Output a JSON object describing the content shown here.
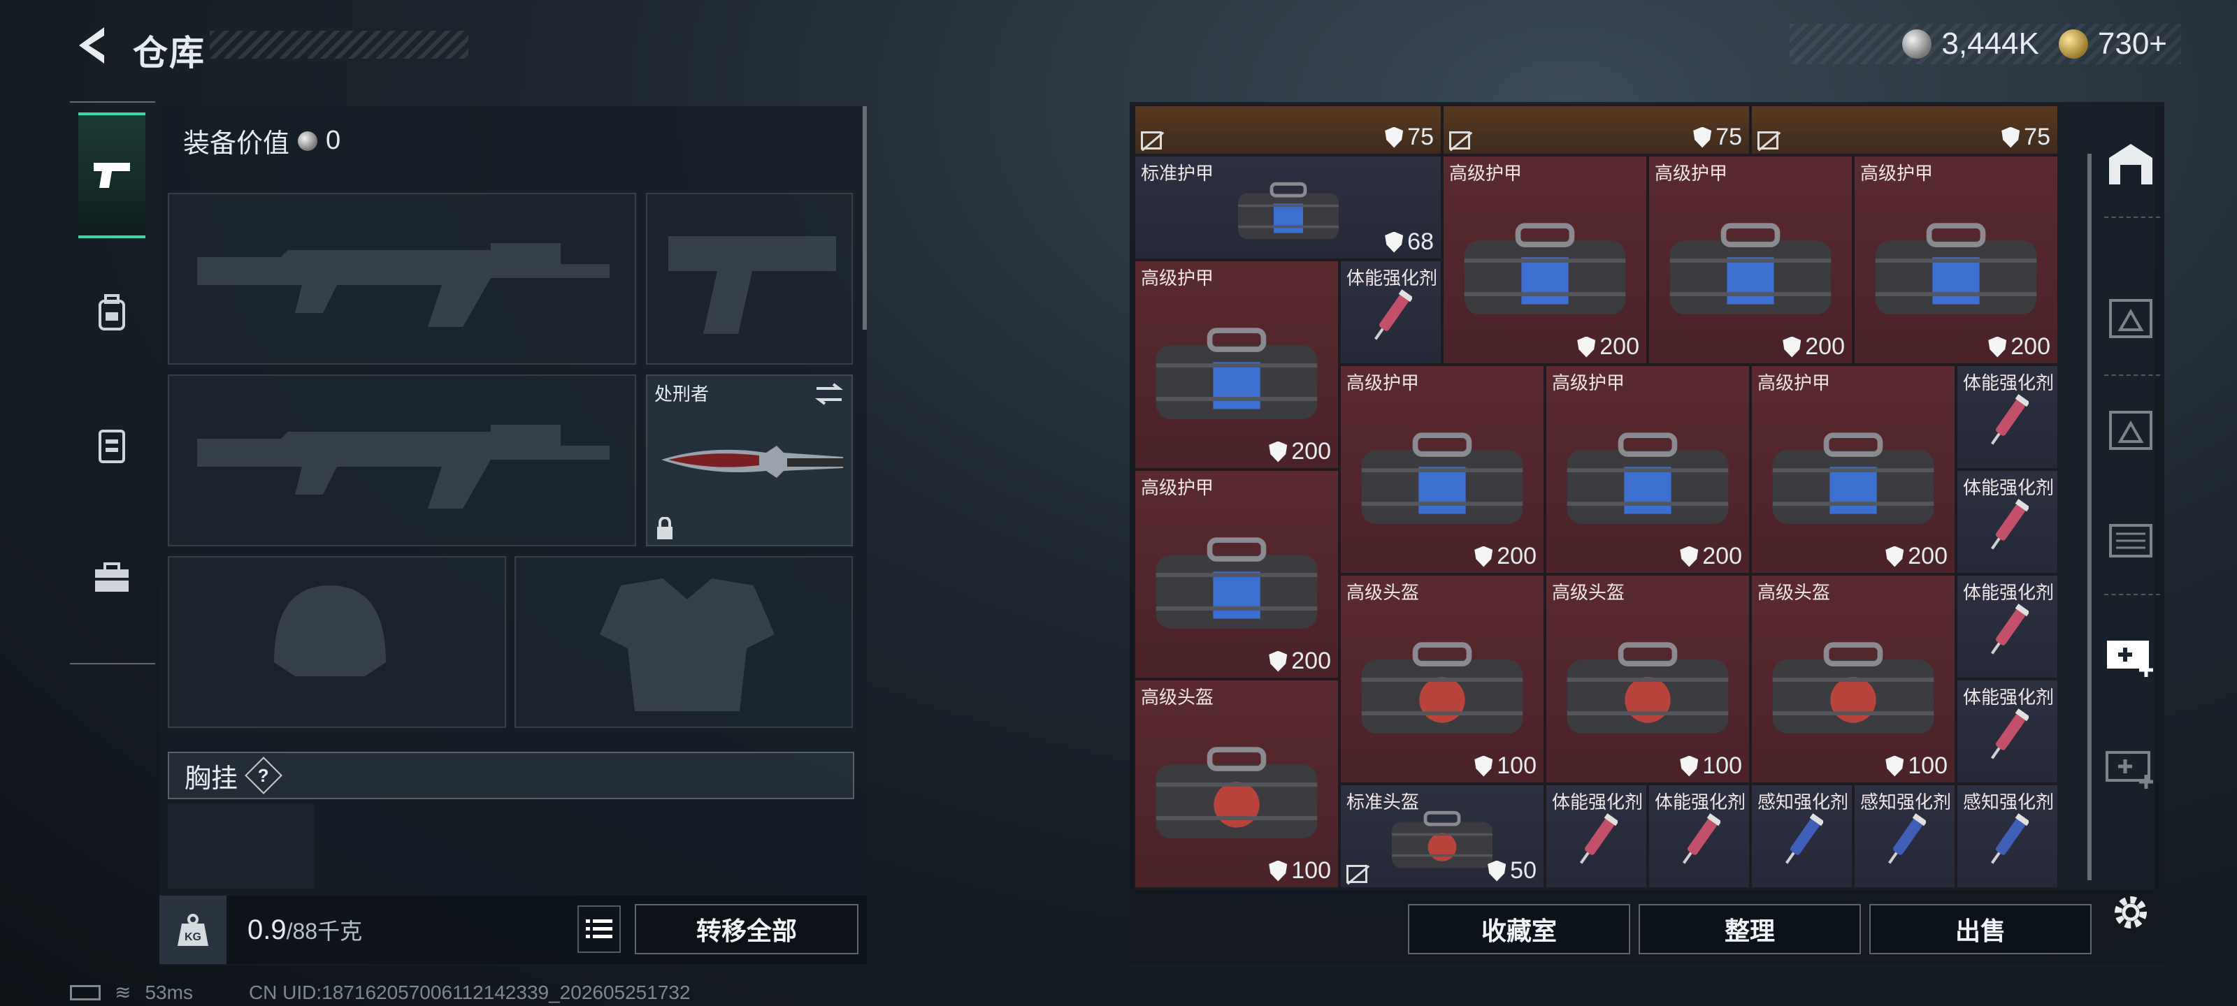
{
  "header": {
    "title": "仓库",
    "silver_amount": "3,444K",
    "gold_amount": "730",
    "gold_plus": "+"
  },
  "loadout": {
    "value_label": "装备价值",
    "value": "0",
    "knife_name": "处刑者",
    "chest_label": "胸挂",
    "chest_help": "?",
    "weight_current": "0.9",
    "weight_max": "/88千克",
    "transfer_all": "转移全部"
  },
  "stash": {
    "top_row": [
      {
        "value": "75"
      },
      {
        "value": "75"
      },
      {
        "value": "75"
      }
    ],
    "cells": [
      {
        "name": "标准护甲",
        "value": "68",
        "color": "dark",
        "type": "armor-bag"
      },
      {
        "name": "高级护甲",
        "value": "200",
        "color": "red",
        "type": "armor-bag"
      },
      {
        "name": "高级护甲",
        "value": "200",
        "color": "red",
        "type": "armor-bag"
      },
      {
        "name": "高级护甲",
        "value": "200",
        "color": "red",
        "type": "armor-bag"
      },
      {
        "name": "高级护甲",
        "value": "200",
        "color": "red",
        "type": "armor-bag"
      },
      {
        "name": "体能强化剂",
        "color": "dark",
        "type": "syringe-red"
      },
      {
        "name": "高级护甲",
        "value": "200",
        "color": "red",
        "type": "armor-bag"
      },
      {
        "name": "高级护甲",
        "value": "200",
        "color": "red",
        "type": "armor-bag"
      },
      {
        "name": "高级护甲",
        "value": "200",
        "color": "red",
        "type": "armor-bag"
      },
      {
        "name": "体能强化剂",
        "color": "dark",
        "type": "syringe-red"
      },
      {
        "name": "高级护甲",
        "value": "200",
        "color": "red",
        "type": "armor-bag"
      },
      {
        "name": "体能强化剂",
        "color": "dark",
        "type": "syringe-red"
      },
      {
        "name": "高级头盔",
        "value": "100",
        "color": "red",
        "type": "helmet-bag"
      },
      {
        "name": "高级头盔",
        "value": "100",
        "color": "red",
        "type": "helmet-bag"
      },
      {
        "name": "高级头盔",
        "value": "100",
        "color": "red",
        "type": "helmet-bag"
      },
      {
        "name": "体能强化剂",
        "color": "dark",
        "type": "syringe-red"
      },
      {
        "name": "高级头盔",
        "value": "100",
        "color": "red",
        "type": "helmet-bag"
      },
      {
        "name": "体能强化剂",
        "color": "dark",
        "type": "syringe-red"
      },
      {
        "name": "标准头盔",
        "value": "50",
        "color": "dark",
        "type": "helmet-bag"
      },
      {
        "name": "体能强化剂",
        "color": "dark",
        "type": "syringe-red"
      },
      {
        "name": "体能强化剂",
        "color": "dark",
        "type": "syringe-red"
      },
      {
        "name": "感知强化剂",
        "color": "dark",
        "type": "syringe-blue"
      },
      {
        "name": "感知强化剂",
        "color": "dark",
        "type": "syringe-blue"
      },
      {
        "name": "感知强化剂",
        "color": "dark",
        "type": "syringe-blue"
      }
    ],
    "btn_collection": "收藏室",
    "btn_sort": "整理",
    "btn_sell": "出售"
  },
  "status": {
    "ping": "53ms",
    "uid": "CN UID:18716205700611214233​9_202605251732"
  }
}
